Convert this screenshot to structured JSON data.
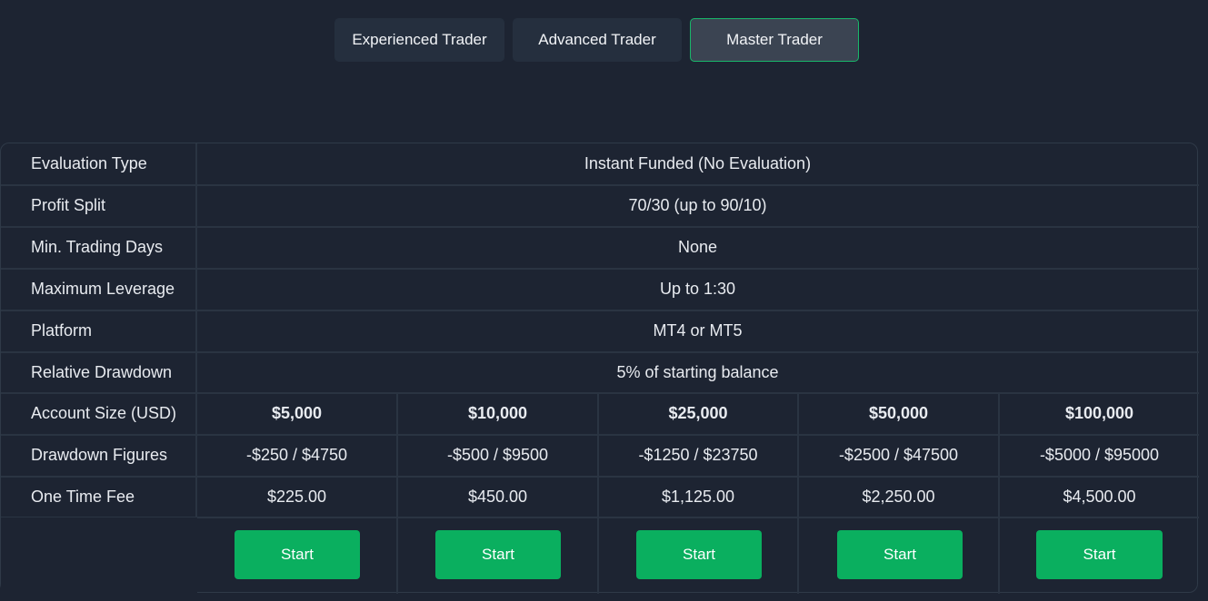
{
  "tabs": [
    {
      "label": "Experienced Trader",
      "active": false
    },
    {
      "label": "Advanced Trader",
      "active": false
    },
    {
      "label": "Master Trader",
      "active": true
    }
  ],
  "rows": [
    {
      "label": "Evaluation Type",
      "value": "Instant Funded (No Evaluation)"
    },
    {
      "label": "Profit Split",
      "value": "70/30 (up to 90/10)"
    },
    {
      "label": "Min. Trading Days",
      "value": "None"
    },
    {
      "label": "Maximum Leverage",
      "value": "Up to 1:30"
    },
    {
      "label": "Platform",
      "value": "MT4 or MT5"
    },
    {
      "label": "Relative Drawdown",
      "value": "5% of starting balance"
    }
  ],
  "account_sizes": {
    "label": "Account Size (USD)",
    "values": [
      "$5,000",
      "$10,000",
      "$25,000",
      "$50,000",
      "$100,000"
    ]
  },
  "drawdown_figures": {
    "label": "Drawdown Figures",
    "values": [
      "-$250 / $4750",
      "-$500 / $9500",
      "-$1250 / $23750",
      "-$2500 / $47500",
      "-$5000 / $95000"
    ]
  },
  "one_time_fee": {
    "label": "One Time Fee",
    "values": [
      "$225.00",
      "$450.00",
      "$1,125.00",
      "$2,250.00",
      "$4,500.00"
    ]
  },
  "start_label": "Start",
  "colors": {
    "background": "#1d2432",
    "accent_green": "#0aaf5f",
    "active_tab_border": "#19b66a"
  }
}
